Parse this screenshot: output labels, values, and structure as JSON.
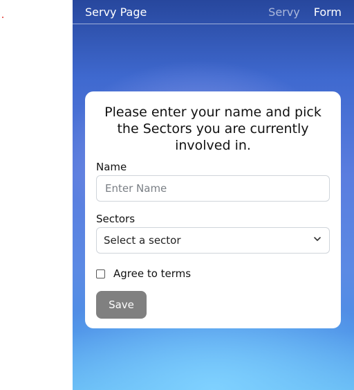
{
  "navbar": {
    "brand": "Servy Page",
    "links": [
      {
        "label": "Servy",
        "active": false
      },
      {
        "label": "Form",
        "active": true
      }
    ]
  },
  "form": {
    "heading": "Please enter your name and pick the Sectors you are currently involved in.",
    "name_label": "Name",
    "name_placeholder": "Enter Name",
    "name_value": "",
    "sectors_label": "Sectors",
    "sectors_selected": "Select a sector",
    "terms_label": "Agree to terms",
    "terms_checked": false,
    "save_label": "Save"
  },
  "colors": {
    "save_button": "#808080",
    "card": "#ffffff"
  }
}
